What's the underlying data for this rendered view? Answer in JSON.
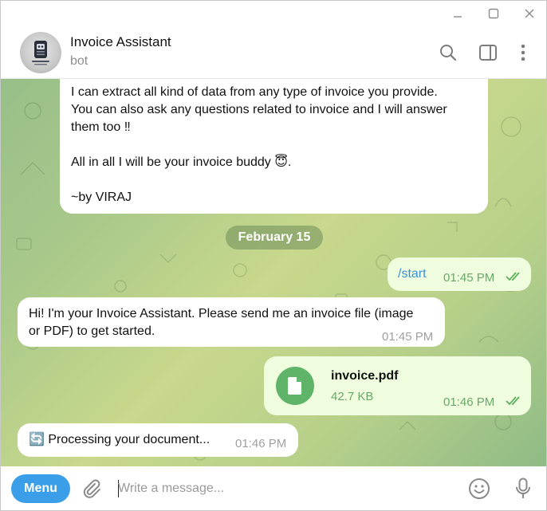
{
  "window": {
    "minimize_icon": "minimize-icon",
    "maximize_icon": "maximize-icon",
    "close_icon": "close-icon"
  },
  "header": {
    "title": "Invoice Assistant",
    "status": "bot",
    "icons": [
      "search-icon",
      "sidebar-toggle-icon",
      "more-vertical-icon"
    ]
  },
  "messages": {
    "intro": {
      "line1": "I can extract all kind of data from any type of invoice you provide.",
      "line2": "You can also ask any questions related to invoice and I will answer",
      "line3": "them too ‼",
      "line4": "All in all I will be your invoice buddy 😇.",
      "line5": "~by VIRAJ"
    },
    "date_separator": "February 15",
    "start": {
      "text": "/start",
      "time": "01:45 PM"
    },
    "greeting": {
      "line1": "Hi! I'm your Invoice Assistant. Please send me an invoice file (image",
      "line2": "or PDF) to get started.",
      "time": "01:45 PM"
    },
    "file": {
      "name": "invoice.pdf",
      "size": "42.7 KB",
      "time": "01:46 PM"
    },
    "processing": {
      "text": "🔄 Processing your document...",
      "time": "01:46 PM"
    }
  },
  "composer": {
    "menu_label": "Menu",
    "placeholder": "Write a message...",
    "icons": [
      "attach-icon",
      "emoji-icon",
      "microphone-icon"
    ]
  },
  "colors": {
    "accent": "#3a9ee8",
    "outgoing_bubble": "#effdde",
    "read_check": "#5fae5f",
    "file_icon_bg": "#5fb46a"
  }
}
